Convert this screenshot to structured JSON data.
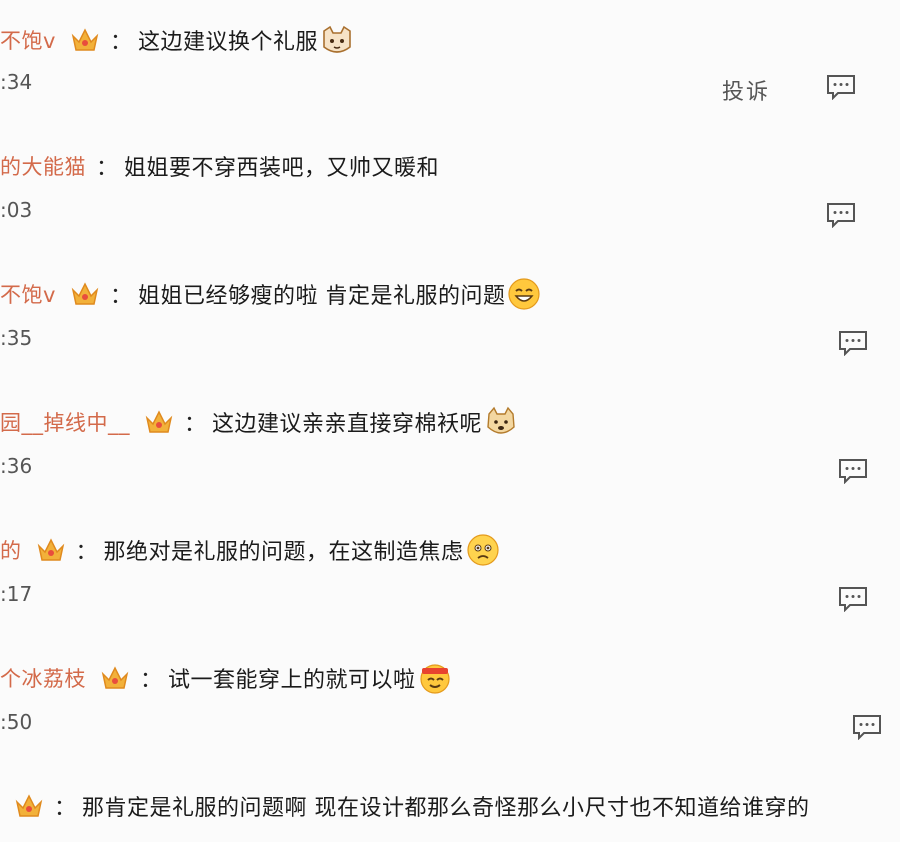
{
  "report_label": "投诉",
  "comments": [
    {
      "user": "不饱v",
      "sep": "：",
      "text": "这边建议换个礼服",
      "time": ":34",
      "emoji": "cat-face"
    },
    {
      "user": "的大能猫",
      "sep": "：",
      "text": "姐姐要不穿西装吧，又帅又暖和",
      "time": ":03",
      "emoji": ""
    },
    {
      "user": "不饱v",
      "sep": "：",
      "text": "姐姐已经够瘦的啦 肯定是礼服的问题",
      "time": ":35",
      "emoji": "grin-face"
    },
    {
      "user": "园__掉线中__",
      "sep": "：",
      "text": "这边建议亲亲直接穿棉袄呢",
      "time": ":36",
      "emoji": "doge-face"
    },
    {
      "user": "的",
      "sep": "：",
      "text": "那绝对是礼服的问题，在这制造焦虑",
      "time": ":17",
      "emoji": "worried-face"
    },
    {
      "user": "个冰荔枝",
      "sep": "：",
      "text": "试一套能穿上的就可以啦",
      "time": ":50",
      "emoji": "headband-face"
    },
    {
      "user": "",
      "sep": "：",
      "text": "那肯定是礼服的问题啊 现在设计都那么奇怪那么小尺寸也不知道给谁穿的",
      "time": "",
      "emoji": ""
    }
  ]
}
